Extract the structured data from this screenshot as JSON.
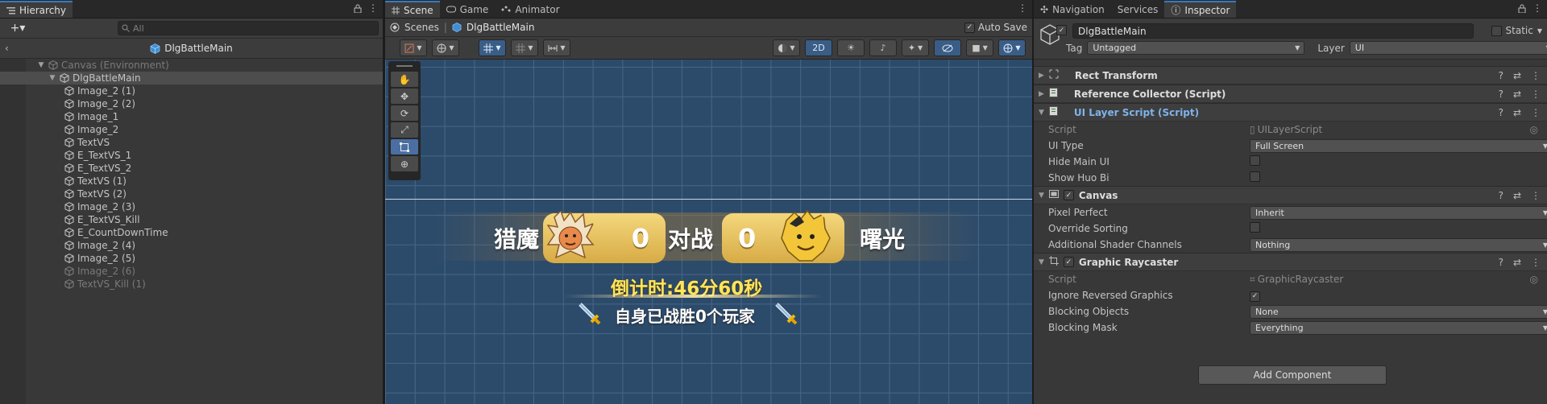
{
  "hierarchy": {
    "tab_label": "Hierarchy",
    "add_label": "+▾",
    "search_placeholder": "All",
    "breadcrumb": "DlgBattleMain",
    "rows": [
      {
        "label": "Canvas (Environment)",
        "depth": 0,
        "expanded": true,
        "dim": true,
        "selected": false
      },
      {
        "label": "DlgBattleMain",
        "depth": 1,
        "expanded": true,
        "dim": false,
        "selected": true
      },
      {
        "label": "Image_2 (1)",
        "depth": 2,
        "dim": false
      },
      {
        "label": "Image_2 (2)",
        "depth": 2,
        "dim": false
      },
      {
        "label": "Image_1",
        "depth": 2,
        "dim": false
      },
      {
        "label": "Image_2",
        "depth": 2,
        "dim": false
      },
      {
        "label": "TextVS",
        "depth": 2,
        "dim": false
      },
      {
        "label": "E_TextVS_1",
        "depth": 2,
        "dim": false
      },
      {
        "label": "E_TextVS_2",
        "depth": 2,
        "dim": false
      },
      {
        "label": "TextVS (1)",
        "depth": 2,
        "dim": false
      },
      {
        "label": "TextVS (2)",
        "depth": 2,
        "dim": false
      },
      {
        "label": "Image_2 (3)",
        "depth": 2,
        "dim": false
      },
      {
        "label": "E_TextVS_Kill",
        "depth": 2,
        "dim": false
      },
      {
        "label": "E_CountDownTime",
        "depth": 2,
        "dim": false
      },
      {
        "label": "Image_2 (4)",
        "depth": 2,
        "dim": false
      },
      {
        "label": "Image_2 (5)",
        "depth": 2,
        "dim": false
      },
      {
        "label": "Image_2 (6)",
        "depth": 2,
        "dim": true
      },
      {
        "label": "TextVS_Kill (1)",
        "depth": 2,
        "dim": true
      }
    ]
  },
  "scene": {
    "tabs": [
      "Scene",
      "Game",
      "Animator"
    ],
    "breadcrumb_root": "Scenes",
    "breadcrumb_current": "DlgBattleMain",
    "auto_save_label": "Auto Save",
    "mode_2d_label": "2D",
    "game_view": {
      "team_left": "猎魔",
      "score_left": "0",
      "vs_label": "对战",
      "score_right": "0",
      "team_right": "曙光",
      "countdown": "倒计时:46分60秒",
      "win_text": "自身已战胜0个玩家"
    }
  },
  "inspector": {
    "tabs": [
      "Navigation",
      "Services",
      "Inspector"
    ],
    "object_name": "DlgBattleMain",
    "static_label": "Static",
    "tag_label": "Tag",
    "tag_value": "Untagged",
    "layer_label": "Layer",
    "layer_value": "UI",
    "components": {
      "rect_transform": "Rect Transform",
      "reference_collector": "Reference Collector (Script)",
      "ui_layer_script": {
        "title": "UI Layer Script (Script)",
        "script_label": "Script",
        "script_value": "UILayerScript",
        "ui_type_label": "UI Type",
        "ui_type_value": "Full Screen",
        "hide_main_ui_label": "Hide Main UI",
        "show_huo_bi_label": "Show Huo Bi"
      },
      "canvas": {
        "title": "Canvas",
        "pixel_perfect_label": "Pixel Perfect",
        "pixel_perfect_value": "Inherit",
        "override_sorting_label": "Override Sorting",
        "shader_channels_label": "Additional Shader Channels",
        "shader_channels_value": "Nothing"
      },
      "graphic_raycaster": {
        "title": "Graphic Raycaster",
        "script_label": "Script",
        "script_value": "GraphicRaycaster",
        "ignore_reversed_label": "Ignore Reversed Graphics",
        "blocking_objects_label": "Blocking Objects",
        "blocking_objects_value": "None",
        "blocking_mask_label": "Blocking Mask",
        "blocking_mask_value": "Everything"
      }
    },
    "add_component_label": "Add Component"
  }
}
